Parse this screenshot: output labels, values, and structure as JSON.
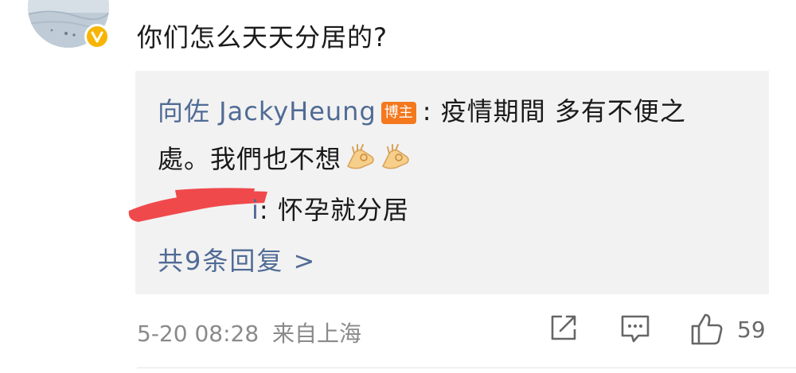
{
  "comment": {
    "text": "你们怎么天天分居的?"
  },
  "reply": {
    "author": "向佐 JackyHeung",
    "badge": "博主",
    "text_line1": ": 疫情期間 多有不便之",
    "text_line2": "處。我們也不想"
  },
  "reply2": {
    "author_visible_suffix": "i",
    "text": ": 怀孕就分居"
  },
  "more_replies": {
    "label": "共9条回复 >"
  },
  "meta": {
    "timestamp": "5-20 08:28",
    "location": "来自上海"
  },
  "actions": {
    "like_count": "59",
    "icons": [
      "share-icon",
      "comment-icon",
      "like-icon"
    ]
  },
  "colors": {
    "link_blue": "#506b95",
    "badge_orange": "#f4781e",
    "verified_yellow": "#f7b500",
    "reply_bg": "#f2f2f2",
    "meta_gray": "#8a8a8a",
    "redaction_red": "#f0494c"
  }
}
